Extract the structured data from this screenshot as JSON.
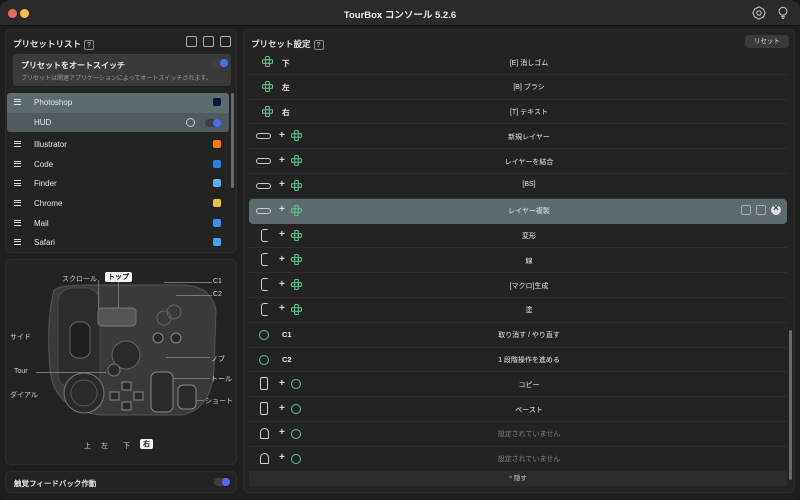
{
  "window": {
    "title": "TourBox コンソール 5.2.6"
  },
  "preset_panel": {
    "title": "プリセットリスト",
    "help": "?",
    "auto_switch": {
      "title": "プリセットをオートスイッチ",
      "desc": "プリセットは関連アプリケーションによってオートスイッチされます。",
      "enabled": true
    },
    "items": [
      {
        "label": "Photoshop",
        "icon": "photoshop-app-icon",
        "color": "#001e36",
        "selected": true
      },
      {
        "label": "HUD",
        "icon": "gear-icon",
        "sub": true
      },
      {
        "label": "Illustrator",
        "icon": "illustrator-app-icon",
        "color": "#ff7c00"
      },
      {
        "label": "Code",
        "icon": "vscode-app-icon",
        "color": "#2f80d8"
      },
      {
        "label": "Finder",
        "icon": "finder-app-icon",
        "color": "#5ab0f0"
      },
      {
        "label": "Chrome",
        "icon": "chrome-app-icon",
        "color": "#e8c53a"
      },
      {
        "label": "Mail",
        "icon": "mail-app-icon",
        "color": "#3a8ff0"
      },
      {
        "label": "Safari",
        "icon": "safari-app-icon",
        "color": "#4aa3f5"
      }
    ]
  },
  "device_diagram": {
    "labels": {
      "scroll": "スクロール",
      "top": "トップ",
      "c1": "C1",
      "c2": "C2",
      "side": "サイド",
      "knob": "ノブ",
      "tour": "Tour",
      "tall": "トール",
      "dial": "ダイアル",
      "short": "ショート",
      "up": "上",
      "left": "左",
      "down": "下",
      "right": "右"
    }
  },
  "haptic": {
    "label": "触覚フィードバック作動",
    "enabled": true
  },
  "settings_panel": {
    "title": "プリセット設定",
    "help": "?",
    "reset_label": "リセット",
    "footer_label": "^  隠す",
    "rows": [
      {
        "input": "下",
        "type": "dpad",
        "action": "[E] 消しゴム"
      },
      {
        "input": "左",
        "type": "dpad",
        "action": "[B] ブラシ"
      },
      {
        "input": "右",
        "type": "dpad",
        "action": "[T] テキスト"
      },
      {
        "input": "+",
        "type": "pill-dpad",
        "action": "新規レイヤー"
      },
      {
        "input": "+",
        "type": "pill-dpad",
        "action": "レイヤーを結合"
      },
      {
        "input": "+",
        "type": "pill-dpad",
        "action": "[BS]"
      },
      {
        "input": "+",
        "type": "pill-dpad",
        "action": "レイヤー複製",
        "highlighted": true
      },
      {
        "input": "+",
        "type": "side-dpad",
        "action": "変形"
      },
      {
        "input": "+",
        "type": "side-dpad",
        "action": "線"
      },
      {
        "input": "+",
        "type": "side-dpad",
        "action": "[マクロ]生成"
      },
      {
        "input": "+",
        "type": "side-dpad",
        "action": "塗"
      },
      {
        "input": "C1",
        "type": "circle",
        "action": "取り消す / やり直す"
      },
      {
        "input": "C2",
        "type": "circle",
        "action": "1 段階操作を進める"
      },
      {
        "input": "+",
        "type": "phone-circle",
        "action": "コピー"
      },
      {
        "input": "+",
        "type": "phone-circle",
        "action": "ペースト"
      },
      {
        "input": "+",
        "type": "bell-circle",
        "action": "設定されていません",
        "dim": true
      },
      {
        "input": "+",
        "type": "bell-circle",
        "action": "設定されていません",
        "dim": true
      }
    ]
  },
  "colors": {
    "accent": "#4a6cf7",
    "selection": "#5d6b70",
    "dpad_green": "#5ec08a"
  }
}
